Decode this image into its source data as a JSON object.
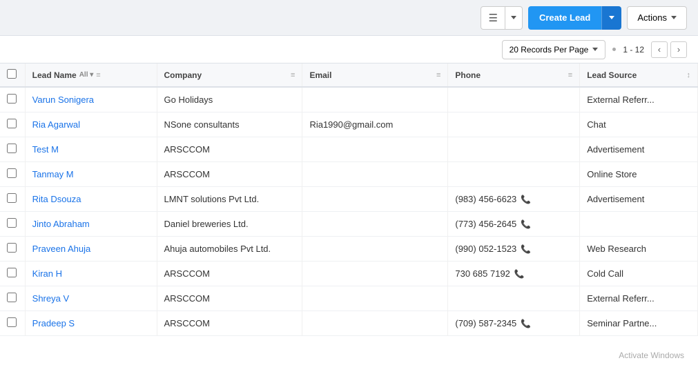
{
  "toolbar": {
    "create_lead_label": "Create Lead",
    "actions_label": "Actions"
  },
  "pagination": {
    "per_page_label": "20 Records Per Page",
    "page_info": "1 - 12",
    "prev_label": "‹",
    "next_label": "›"
  },
  "table": {
    "columns": [
      {
        "id": "lead_name",
        "label": "Lead Name",
        "filter": "All"
      },
      {
        "id": "company",
        "label": "Company"
      },
      {
        "id": "email",
        "label": "Email"
      },
      {
        "id": "phone",
        "label": "Phone"
      },
      {
        "id": "lead_source",
        "label": "Lead Source"
      }
    ],
    "rows": [
      {
        "lead_name": "Varun Sonigera",
        "company": "Go Holidays",
        "email": "",
        "phone": "",
        "lead_source": "External Referr..."
      },
      {
        "lead_name": "Ria Agarwal",
        "company": "NSone consultants",
        "email": "Ria1990@gmail.com",
        "phone": "",
        "lead_source": "Chat"
      },
      {
        "lead_name": "Test M",
        "company": "ARSCCOM",
        "email": "",
        "phone": "",
        "lead_source": "Advertisement"
      },
      {
        "lead_name": "Tanmay M",
        "company": "ARSCCOM",
        "email": "",
        "phone": "",
        "lead_source": "Online Store"
      },
      {
        "lead_name": "Rita Dsouza",
        "company": "LMNT solutions Pvt Ltd.",
        "email": "",
        "phone": "(983) 456-6623",
        "lead_source": "Advertisement"
      },
      {
        "lead_name": "Jinto Abraham",
        "company": "Daniel breweries Ltd.",
        "email": "",
        "phone": "(773) 456-2645",
        "lead_source": ""
      },
      {
        "lead_name": "Praveen Ahuja",
        "company": "Ahuja automobiles Pvt Ltd.",
        "email": "",
        "phone": "(990) 052-1523",
        "lead_source": "Web Research"
      },
      {
        "lead_name": "Kiran H",
        "company": "ARSCCOM",
        "email": "",
        "phone": "730 685 7192",
        "lead_source": "Cold Call"
      },
      {
        "lead_name": "Shreya V",
        "company": "ARSCCOM",
        "email": "",
        "phone": "",
        "lead_source": "External Referr..."
      },
      {
        "lead_name": "Pradeep S",
        "company": "ARSCCOM",
        "email": "",
        "phone": "(709) 587-2345",
        "lead_source": "Seminar Partne..."
      }
    ]
  },
  "watermark": "Activate Windows"
}
